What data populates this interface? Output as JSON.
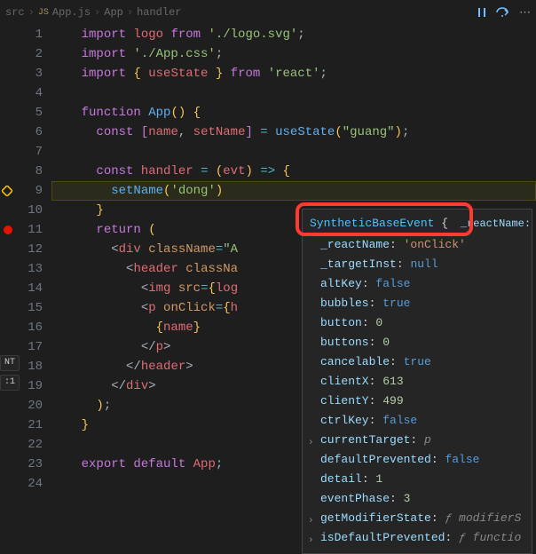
{
  "breadcrumb": {
    "file": "src",
    "sep1": "›",
    "fileIcon": "JS",
    "fileName": "App.js",
    "sep2": "›",
    "symbol1": "App",
    "sep3": "›",
    "symbol2": "handler"
  },
  "topActions": {
    "pause": "Pause",
    "stepOver": "Step Over",
    "more": "More"
  },
  "gutter": {
    "debugCurrentLine": 9,
    "breakpointLine": 11,
    "ntBadge": "NT",
    "ratioBadge": ":1"
  },
  "lines": [
    {
      "n": 1,
      "tokens": [
        [
          "k-import",
          "import "
        ],
        [
          "k-default",
          "logo"
        ],
        [
          "k-plain",
          " "
        ],
        [
          "k-from",
          "from "
        ],
        [
          "k-str",
          "'./logo.svg'"
        ],
        [
          "k-plain",
          ";"
        ]
      ]
    },
    {
      "n": 2,
      "tokens": [
        [
          "k-import",
          "import "
        ],
        [
          "k-str",
          "'./App.css'"
        ],
        [
          "k-plain",
          ";"
        ]
      ]
    },
    {
      "n": 3,
      "tokens": [
        [
          "k-import",
          "import "
        ],
        [
          "k-paren",
          "{ "
        ],
        [
          "k-ident",
          "useState"
        ],
        [
          "k-paren",
          " }"
        ],
        [
          "k-plain",
          " "
        ],
        [
          "k-from",
          "from "
        ],
        [
          "k-str",
          "'react'"
        ],
        [
          "k-plain",
          ";"
        ]
      ]
    },
    {
      "n": 4,
      "tokens": []
    },
    {
      "n": 5,
      "tokens": [
        [
          "k-keyword",
          "function "
        ],
        [
          "k-func",
          "App"
        ],
        [
          "k-paren",
          "()"
        ],
        [
          "k-plain",
          " "
        ],
        [
          "k-paren",
          "{"
        ]
      ]
    },
    {
      "n": 6,
      "tokens": [
        [
          "k-plain",
          "  "
        ],
        [
          "k-keyword",
          "const "
        ],
        [
          "k-paren2",
          "["
        ],
        [
          "k-ident",
          "name"
        ],
        [
          "k-plain",
          ", "
        ],
        [
          "k-ident",
          "setName"
        ],
        [
          "k-paren2",
          "]"
        ],
        [
          "k-plain",
          " "
        ],
        [
          "k-op",
          "="
        ],
        [
          "k-plain",
          " "
        ],
        [
          "k-func",
          "useState"
        ],
        [
          "k-paren",
          "("
        ],
        [
          "k-str",
          "\"guang\""
        ],
        [
          "k-paren",
          ")"
        ],
        [
          "k-plain",
          ";"
        ]
      ]
    },
    {
      "n": 7,
      "tokens": []
    },
    {
      "n": 8,
      "tokens": [
        [
          "k-plain",
          "  "
        ],
        [
          "k-keyword",
          "const "
        ],
        [
          "k-ident",
          "handler"
        ],
        [
          "k-plain",
          " "
        ],
        [
          "k-op",
          "="
        ],
        [
          "k-plain",
          " "
        ],
        [
          "k-paren",
          "("
        ],
        [
          "k-ident",
          "evt"
        ],
        [
          "k-paren",
          ")"
        ],
        [
          "k-plain",
          " "
        ],
        [
          "k-op",
          "=>"
        ],
        [
          "k-plain",
          " "
        ],
        [
          "k-paren",
          "{"
        ]
      ]
    },
    {
      "n": 9,
      "tokens": [
        [
          "k-plain",
          "    "
        ],
        [
          "k-func",
          "setName"
        ],
        [
          "k-paren",
          "("
        ],
        [
          "k-str",
          "'dong'"
        ],
        [
          "k-paren",
          ")"
        ]
      ]
    },
    {
      "n": 10,
      "tokens": [
        [
          "k-plain",
          "  "
        ],
        [
          "k-paren",
          "}"
        ]
      ]
    },
    {
      "n": 11,
      "tokens": [
        [
          "k-plain",
          "  "
        ],
        [
          "k-keyword",
          "return "
        ],
        [
          "k-paren",
          "("
        ]
      ]
    },
    {
      "n": 12,
      "tokens": [
        [
          "k-plain",
          "    "
        ],
        [
          "k-jsxp",
          "<"
        ],
        [
          "k-tag",
          "div"
        ],
        [
          "k-plain",
          " "
        ],
        [
          "k-attr",
          "className"
        ],
        [
          "k-op",
          "="
        ],
        [
          "k-str",
          "\"A"
        ]
      ]
    },
    {
      "n": 13,
      "tokens": [
        [
          "k-plain",
          "      "
        ],
        [
          "k-jsxp",
          "<"
        ],
        [
          "k-tag",
          "header"
        ],
        [
          "k-plain",
          " "
        ],
        [
          "k-attr",
          "classNa"
        ]
      ]
    },
    {
      "n": 14,
      "tokens": [
        [
          "k-plain",
          "        "
        ],
        [
          "k-jsxp",
          "<"
        ],
        [
          "k-tag",
          "img"
        ],
        [
          "k-plain",
          " "
        ],
        [
          "k-attr",
          "src"
        ],
        [
          "k-op",
          "="
        ],
        [
          "k-paren",
          "{"
        ],
        [
          "k-ident",
          "log"
        ]
      ]
    },
    {
      "n": 15,
      "tokens": [
        [
          "k-plain",
          "        "
        ],
        [
          "k-jsxp",
          "<"
        ],
        [
          "k-tag",
          "p"
        ],
        [
          "k-plain",
          " "
        ],
        [
          "k-attr",
          "onClick"
        ],
        [
          "k-op",
          "="
        ],
        [
          "k-paren",
          "{"
        ],
        [
          "k-ident",
          "h"
        ]
      ]
    },
    {
      "n": 16,
      "tokens": [
        [
          "k-plain",
          "          "
        ],
        [
          "k-paren",
          "{"
        ],
        [
          "k-ident",
          "name"
        ],
        [
          "k-paren",
          "}"
        ]
      ]
    },
    {
      "n": 17,
      "tokens": [
        [
          "k-plain",
          "        "
        ],
        [
          "k-jsxp",
          "</"
        ],
        [
          "k-tag",
          "p"
        ],
        [
          "k-jsxp",
          ">"
        ]
      ]
    },
    {
      "n": 18,
      "tokens": [
        [
          "k-plain",
          "      "
        ],
        [
          "k-jsxp",
          "</"
        ],
        [
          "k-tag",
          "header"
        ],
        [
          "k-jsxp",
          ">"
        ]
      ]
    },
    {
      "n": 19,
      "tokens": [
        [
          "k-plain",
          "    "
        ],
        [
          "k-jsxp",
          "</"
        ],
        [
          "k-tag",
          "div"
        ],
        [
          "k-jsxp",
          ">"
        ]
      ]
    },
    {
      "n": 20,
      "tokens": [
        [
          "k-plain",
          "  "
        ],
        [
          "k-paren",
          ")"
        ],
        [
          "k-plain",
          ";"
        ]
      ]
    },
    {
      "n": 21,
      "tokens": [
        [
          "k-paren",
          "}"
        ]
      ]
    },
    {
      "n": 22,
      "tokens": []
    },
    {
      "n": 23,
      "tokens": [
        [
          "k-keyword",
          "export "
        ],
        [
          "k-keyword",
          "default "
        ],
        [
          "k-ident",
          "App"
        ],
        [
          "k-plain",
          ";"
        ]
      ]
    },
    {
      "n": 24,
      "tokens": []
    }
  ],
  "hover": {
    "title": "SyntheticBaseEvent",
    "brace": "{",
    "tail": "_reactName:",
    "props": [
      {
        "key": "_reactName",
        "value": "'onClick'",
        "type": "str"
      },
      {
        "key": "_targetInst",
        "value": "null",
        "type": "bool"
      },
      {
        "key": "altKey",
        "value": "false",
        "type": "bool"
      },
      {
        "key": "bubbles",
        "value": "true",
        "type": "bool"
      },
      {
        "key": "button",
        "value": "0",
        "type": "num"
      },
      {
        "key": "buttons",
        "value": "0",
        "type": "num"
      },
      {
        "key": "cancelable",
        "value": "true",
        "type": "bool"
      },
      {
        "key": "clientX",
        "value": "613",
        "type": "num"
      },
      {
        "key": "clientY",
        "value": "499",
        "type": "num"
      },
      {
        "key": "ctrlKey",
        "value": "false",
        "type": "bool"
      },
      {
        "key": "currentTarget",
        "value": "p",
        "type": "func",
        "expandable": true
      },
      {
        "key": "defaultPrevented",
        "value": "false",
        "type": "bool"
      },
      {
        "key": "detail",
        "value": "1",
        "type": "num"
      },
      {
        "key": "eventPhase",
        "value": "3",
        "type": "num"
      },
      {
        "key": "getModifierState",
        "value": "ƒ modifierS",
        "type": "func",
        "expandable": true
      },
      {
        "key": "isDefaultPrevented",
        "value": "ƒ functio",
        "type": "func",
        "expandable": true
      }
    ]
  }
}
